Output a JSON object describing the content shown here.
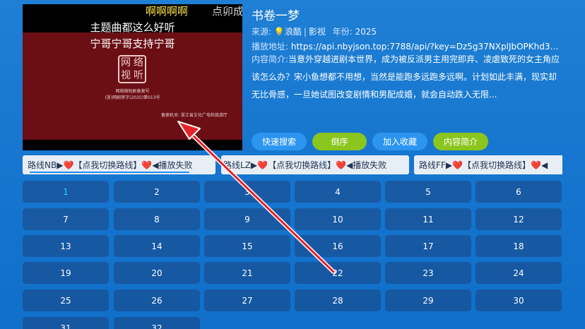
{
  "player": {
    "top_text": "啊啊啊啊",
    "scroll_text": "点卯成",
    "line1": "主题曲都这么好听",
    "line2": "宁哥宁哥支持宁哥",
    "seal_chars": [
      "网",
      "络",
      "视",
      "听"
    ],
    "small_line1": "网络微短剧备案号",
    "small_line2": "(浙)网剧审字(2025)第013号",
    "small_line3": "备案机关: 浙江省文化广电和旅游厅"
  },
  "info": {
    "title": "书卷一梦",
    "source_label": "来源:",
    "source_name": "浪酷",
    "source_type": "影视",
    "year_label": "年份:",
    "year": "2025",
    "url_label": "播放地址:",
    "url": "https://api.nbyjson.top:7788/api/?key=Dz5g37NXplJbOPKhd3&...",
    "desc_label": "内容简介:",
    "desc": "当意外穿越进剧本世界，成为被反派男主用完即弃、凌虐致死的女主角应该怎么办？宋小鱼想都不用想，当然是能跑多远跑多远啊。计划如此丰满，现实却无比骨感，一旦她试图改变剧情和男配成婚，就会自动跌入无限..."
  },
  "actions": [
    {
      "label": "快速搜索",
      "color": "#2c95f0"
    },
    {
      "label": "倒序",
      "color": "#8ac61e"
    },
    {
      "label": "加入收藏",
      "color": "#2c95f0"
    },
    {
      "label": "内容简介",
      "color": "#8ac61e"
    }
  ],
  "routes": [
    {
      "name": "路线NB",
      "pre": "▶",
      "mid": "【点我切换路线】",
      "post": "◀播放失败"
    },
    {
      "name": "路线LZ",
      "pre": "▶",
      "mid": "【点我切换路线】",
      "post": "◀播放失败"
    },
    {
      "name": "路线FF",
      "pre": "▶",
      "mid": "【点我切换路线】",
      "post": "◀"
    }
  ],
  "heart": "❤️",
  "episodes": [
    "1",
    "2",
    "3",
    "4",
    "5",
    "6",
    "7",
    "8",
    "9",
    "10",
    "11",
    "12",
    "13",
    "14",
    "15",
    "16",
    "17",
    "18",
    "19",
    "20",
    "21",
    "22",
    "23",
    "24",
    "25",
    "26",
    "27",
    "28",
    "29",
    "30",
    "31",
    "32"
  ],
  "active_episode": "1"
}
